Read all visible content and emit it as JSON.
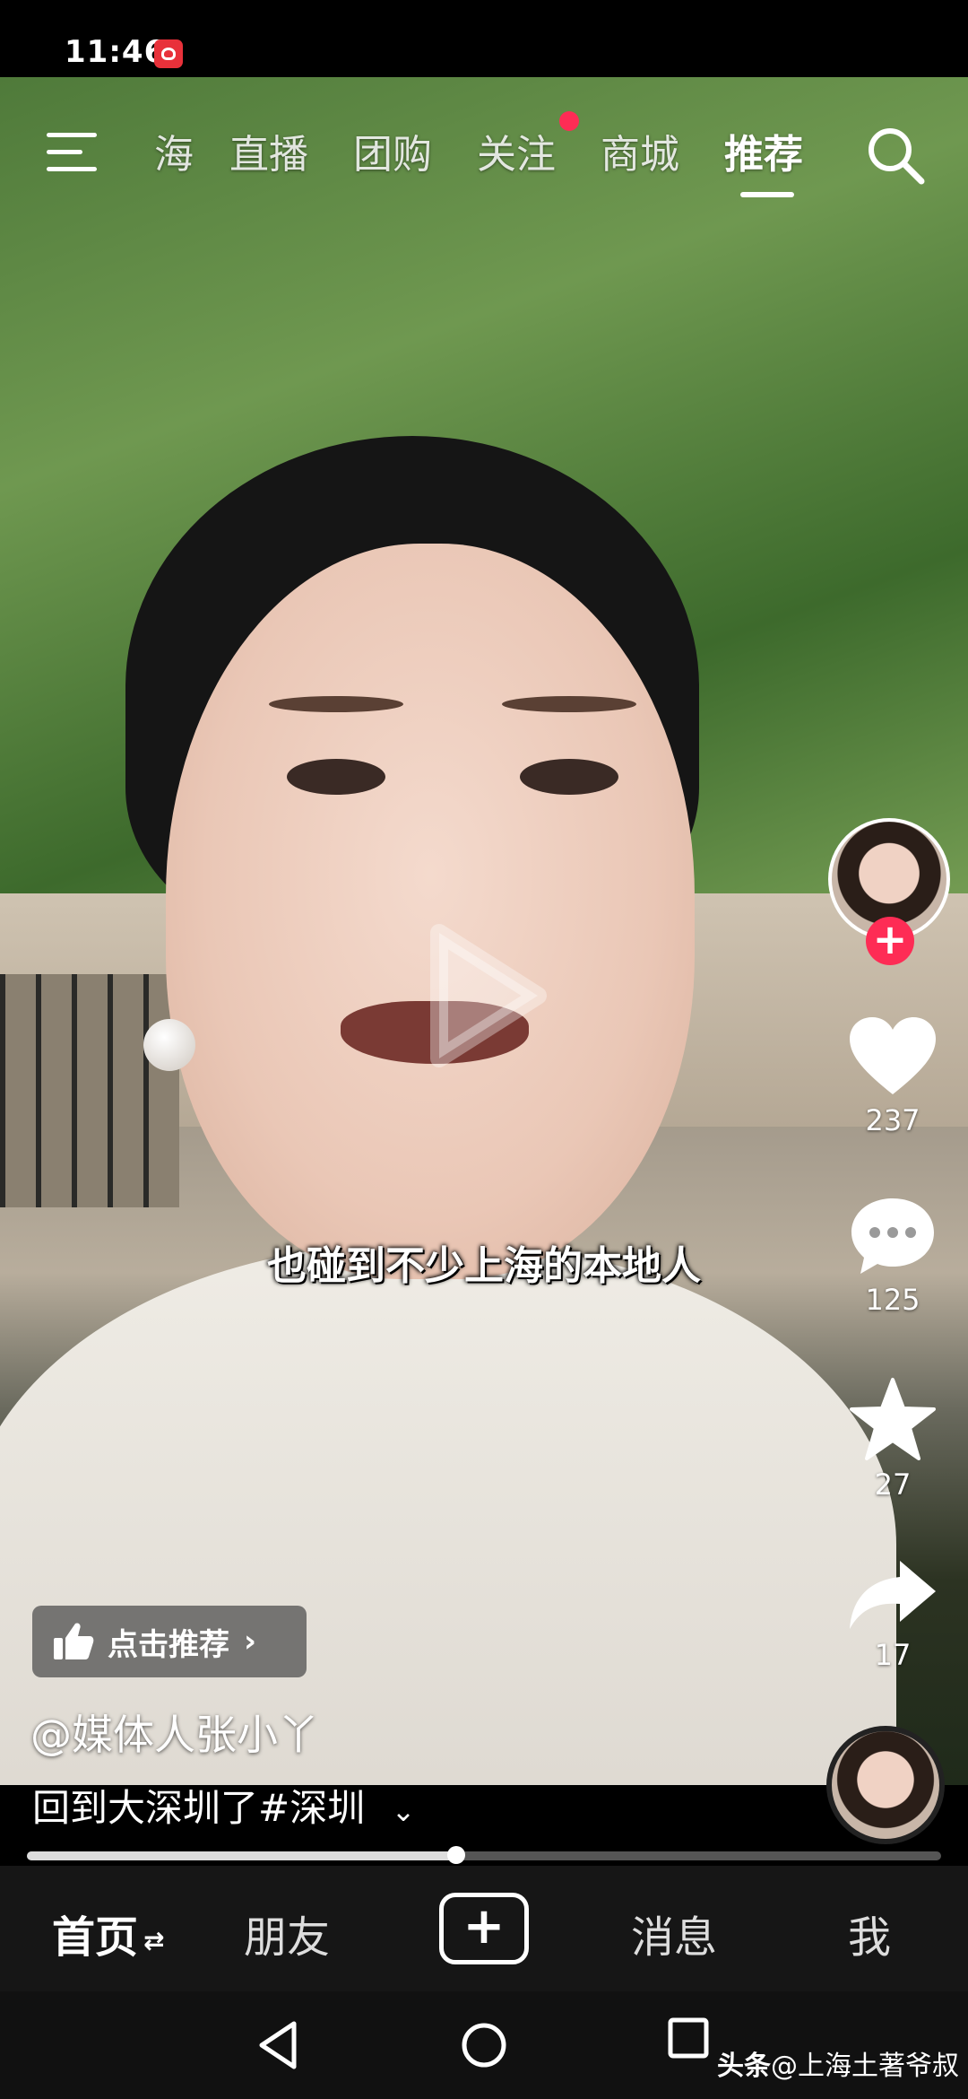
{
  "status_bar": {
    "time": "11:46",
    "notification_icon": "heart-badge-icon"
  },
  "top_tabs": [
    {
      "label": "海"
    },
    {
      "label": "直播"
    },
    {
      "label": "团购"
    },
    {
      "label": "关注",
      "has_dot": true
    },
    {
      "label": "商城"
    },
    {
      "label": "推荐",
      "active": true
    }
  ],
  "video": {
    "subtitle": "也碰到不少上海的本地人",
    "author": "@媒体人张小丫",
    "description": "回到大深圳了#深圳",
    "recommend_label": "点击推荐",
    "progress_fraction": 0.47
  },
  "actions": {
    "likes": "237",
    "comments": "125",
    "favorites": "27",
    "shares": "17"
  },
  "bottom_nav": {
    "home": "首页",
    "friends": "朋友",
    "messages": "消息",
    "me": "我"
  },
  "watermark": {
    "brand": "头条",
    "handle": "@上海土著爷叔"
  },
  "colors": {
    "accent": "#fe2c55",
    "nav_bg": "#161616"
  }
}
